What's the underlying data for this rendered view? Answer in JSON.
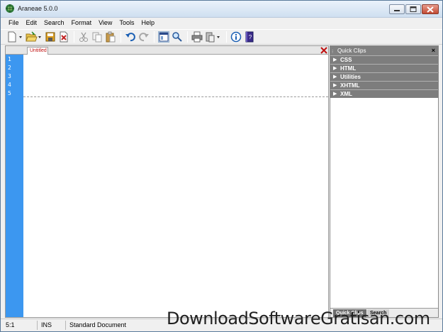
{
  "window": {
    "title": "Araneae 5.0.0"
  },
  "menu": [
    "File",
    "Edit",
    "Search",
    "Format",
    "View",
    "Tools",
    "Help"
  ],
  "toolbar": {
    "buttons": [
      "new-file-icon",
      "open-folder-icon",
      "save-icon",
      "close-file-icon",
      "cut-icon",
      "copy-icon",
      "paste-icon",
      "undo-icon",
      "redo-icon",
      "preview-icon",
      "find-icon",
      "print-icon",
      "paste-special-icon",
      "info-icon",
      "help-icon"
    ]
  },
  "editor": {
    "tab_label": "Untitled",
    "line_numbers": [
      "1",
      "2",
      "3",
      "4",
      "5"
    ]
  },
  "clips": {
    "title": "Quick Clips",
    "close": "×",
    "items": [
      "CSS",
      "HTML",
      "Utilities",
      "XHTML",
      "XML"
    ],
    "tabs": [
      "Quick Clips",
      "Search"
    ]
  },
  "status": {
    "position": "5:1",
    "mode": "INS",
    "doc_type": "Standard Document"
  },
  "watermark": "DownloadSoftwareGratisan.com",
  "colors": {
    "gutter": "#3c97f0",
    "panel_header": "#808080",
    "tab_text": "#c01010"
  }
}
